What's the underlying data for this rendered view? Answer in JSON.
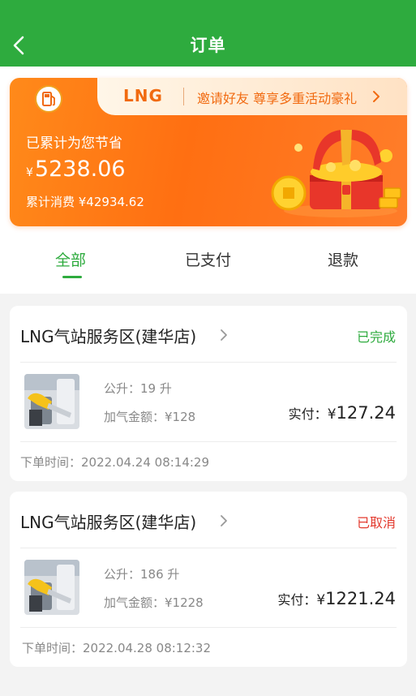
{
  "header": {
    "title": "订单",
    "back_icon": "chevron-left-icon"
  },
  "banner": {
    "brand": "LNG",
    "invite_text": "邀请好友 尊享多重活动豪礼",
    "saved_label": "已累计为您节省",
    "currency": "¥",
    "saved_amount": "5238.06",
    "total_text": "累计消费 ¥42934.62",
    "icon": "fuel-pump-icon",
    "illustration": "treasure-chest-icon"
  },
  "tabs": [
    {
      "label": "全部",
      "active": true
    },
    {
      "label": "已支付",
      "active": false
    },
    {
      "label": "退款",
      "active": false
    }
  ],
  "orders": [
    {
      "station": "LNG气站服务区(建华店)",
      "status": "已完成",
      "status_color": "#2eab3e",
      "liters_text": "公升：19 升",
      "amount_text": "加气金额：¥128",
      "paid_label": "实付：",
      "paid_currency": "¥",
      "paid_value": "127.24",
      "time_text": "下单时间：2022.04.24  08:14:29"
    },
    {
      "station": "LNG气站服务区(建华店)",
      "status": "已取消",
      "status_color": "#e33a2e",
      "liters_text": "公升：186 升",
      "amount_text": "加气金额：¥1228",
      "paid_label": "实付：",
      "paid_currency": "¥",
      "paid_value": "1221.24",
      "time_text": "下单时间：2022.04.28  08:12:32"
    }
  ],
  "colors": {
    "brand_green": "#2eab3e",
    "banner_orange": "#ff7a18",
    "cancel_red": "#e33a2e"
  }
}
